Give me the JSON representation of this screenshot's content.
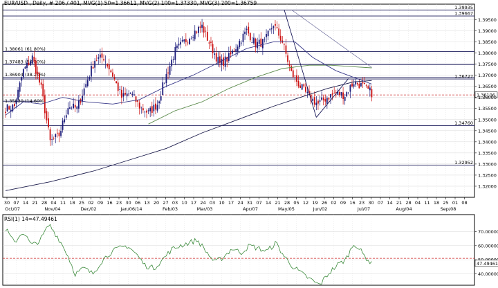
{
  "header": {
    "main_info": "EUR/USD , Daily, # 206 / 401, MVG(1) 50=1.36611, MVG(2) 100=1.37330, MVG(3) 200=1.36759",
    "rsi_info": "RSI(1) 14=47.49461"
  },
  "colors": {
    "background": "#ffffff",
    "grid": "#d8d8d8",
    "up_candle": "#1a1a7a",
    "down_candle": "#cc1111",
    "ma50": "#3a3a8a",
    "ma100": "#5a8a4a",
    "ma200": "#1a1a4a",
    "fib_line": "#1a1a5a",
    "current_price_line": "#cc3333",
    "rsi_line": "#3a8a3a",
    "rsi_midline": "#cc2222"
  },
  "chart_data": [
    {
      "type": "candlestick",
      "title": "EUR/USD , Daily",
      "ylim": [
        1.315,
        1.402
      ],
      "y_ticks": [
        "1.39500",
        "1.39000",
        "1.38500",
        "1.38000",
        "1.37500",
        "1.37000",
        "1.36500",
        "1.36000",
        "1.35500",
        "1.35000",
        "1.34500",
        "1.34000",
        "1.33500",
        "1.33000",
        "1.32500",
        "1.32000"
      ],
      "x_tick_labels": [
        "30",
        "07",
        "14",
        "21",
        "28",
        "04",
        "11",
        "18",
        "25",
        "02",
        "09",
        "16",
        "23",
        "30",
        "06",
        "13",
        "20",
        "27",
        "03",
        "10",
        "17",
        "24",
        "03",
        "10",
        "17",
        "24",
        "31",
        "07",
        "14",
        "21",
        "28",
        "05",
        "12",
        "19",
        "26",
        "02",
        "09",
        "16",
        "23",
        "30",
        "07",
        "14",
        "21",
        "28",
        "04",
        "11",
        "18",
        "25",
        "01",
        "08",
        "15",
        "22"
      ],
      "month_labels": [
        "Oct/07",
        "Nov/04",
        "Dec/02",
        "Jan/06/14",
        "Feb/03",
        "Mar/03",
        "Apr/07",
        "May/05",
        "Jun/02",
        "Jul/07",
        "Aug/04",
        "Sep/08"
      ],
      "close_waypoints": [
        1.355,
        1.356,
        1.372,
        1.378,
        1.364,
        1.34,
        1.343,
        1.356,
        1.355,
        1.366,
        1.377,
        1.378,
        1.37,
        1.36,
        1.362,
        1.356,
        1.353,
        1.357,
        1.37,
        1.381,
        1.385,
        1.389,
        1.392,
        1.383,
        1.375,
        1.378,
        1.384,
        1.39,
        1.384,
        1.385,
        1.393,
        1.385,
        1.371,
        1.365,
        1.36,
        1.357,
        1.36,
        1.362,
        1.361,
        1.367,
        1.365,
        1.362
      ],
      "levels": [
        {
          "price": 1.39935,
          "label": "1.39935"
        },
        {
          "price": 1.39667,
          "label": "1.39667"
        },
        {
          "price": 1.38061,
          "label": "1.38061 (61.80%)"
        },
        {
          "price": 1.37483,
          "label": "1.37483 (50.00%)"
        },
        {
          "price": 1.36904,
          "label": "1.36904 (38.20%)"
        },
        {
          "price": 1.3683,
          "label": "1.36727"
        },
        {
          "price": 1.3473,
          "label": "1.34760"
        },
        {
          "price": 1.32952,
          "label": "1.32952"
        }
      ],
      "partial_level": {
        "price": 1.3583,
        "label": "1.35830 (14.60%)"
      },
      "current_price": {
        "value": 1.3611,
        "label": "1.36106"
      },
      "ma50": [
        [
          0,
          1.352
        ],
        [
          10,
          1.358
        ],
        [
          20,
          1.357
        ],
        [
          32,
          1.36
        ],
        [
          45,
          1.358
        ],
        [
          60,
          1.357
        ],
        [
          75,
          1.359
        ],
        [
          90,
          1.365
        ],
        [
          105,
          1.37
        ],
        [
          120,
          1.376
        ],
        [
          135,
          1.382
        ],
        [
          150,
          1.385
        ],
        [
          162,
          1.385
        ],
        [
          172,
          1.378
        ],
        [
          185,
          1.372
        ],
        [
          195,
          1.369
        ],
        [
          205,
          1.366
        ]
      ],
      "ma100": [
        [
          80,
          1.348
        ],
        [
          95,
          1.354
        ],
        [
          110,
          1.358
        ],
        [
          125,
          1.364
        ],
        [
          140,
          1.369
        ],
        [
          155,
          1.373
        ],
        [
          170,
          1.3745
        ],
        [
          182,
          1.3745
        ],
        [
          195,
          1.3738
        ],
        [
          205,
          1.3733
        ]
      ],
      "ma200": [
        [
          0,
          1.318
        ],
        [
          25,
          1.322
        ],
        [
          50,
          1.327
        ],
        [
          70,
          1.332
        ],
        [
          90,
          1.337
        ],
        [
          110,
          1.344
        ],
        [
          130,
          1.35
        ],
        [
          150,
          1.356
        ],
        [
          165,
          1.36
        ],
        [
          180,
          1.364
        ],
        [
          195,
          1.367
        ],
        [
          205,
          1.3676
        ]
      ]
    },
    {
      "type": "line",
      "title": "RSI(1) 14",
      "ylim": [
        30,
        80
      ],
      "y_ticks": [
        "70.00000",
        "60.00000",
        "50.00000",
        "40.00000",
        "30.00000"
      ],
      "current": {
        "value": 47.49461,
        "label": "47.49461"
      },
      "midline": 51,
      "waypoints": [
        72,
        62,
        70,
        60,
        64,
        75,
        66,
        55,
        40,
        44,
        40,
        49,
        55,
        58,
        60,
        54,
        46,
        44,
        50,
        57,
        60,
        62,
        64,
        56,
        48,
        52,
        58,
        55,
        60,
        58,
        56,
        62,
        52,
        45,
        40,
        36,
        32,
        40,
        46,
        50,
        62,
        54,
        47
      ]
    }
  ]
}
